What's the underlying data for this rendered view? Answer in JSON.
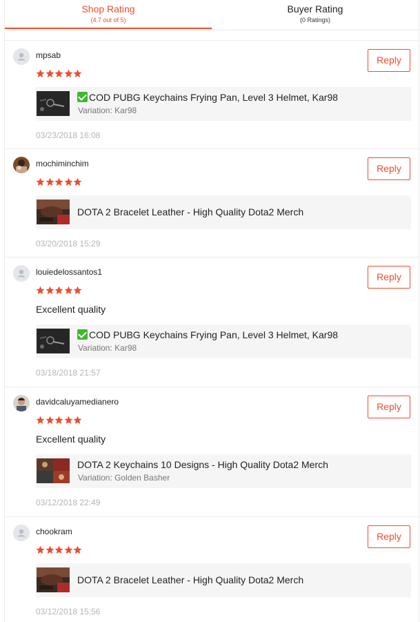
{
  "tabs": {
    "shop": {
      "title": "Shop Rating",
      "subtitle": "(4.7 out of 5)"
    },
    "buyer": {
      "title": "Buyer Rating",
      "subtitle": "(0 Ratings)"
    }
  },
  "colors": {
    "accent": "#ee4d2d",
    "star": "#ee4d2d",
    "check": "#3fb82f"
  },
  "reviews": [
    {
      "username": "mpsab",
      "rating": 5,
      "comment": "",
      "product": "COD PUBG Keychains Frying Pan, Level 3 Helmet, Kar98",
      "has_check": true,
      "variation": "Variation: Kar98",
      "date": "03/23/2018 16:08",
      "reply_label": "Reply",
      "avatar": "default-avatar-icon"
    },
    {
      "username": "mochiminchim",
      "rating": 5,
      "comment": "",
      "product": "DOTA 2 Bracelet Leather - High Quality Dota2 Merch",
      "has_check": false,
      "variation": "",
      "date": "03/20/2018 15:29",
      "reply_label": "Reply",
      "avatar": "user-photo"
    },
    {
      "username": "louiedelossantos1",
      "rating": 5,
      "comment": "Excellent quality",
      "product": "COD PUBG Keychains Frying Pan, Level 3 Helmet, Kar98",
      "has_check": true,
      "variation": "Variation: Kar98",
      "date": "03/18/2018 21:57",
      "reply_label": "Reply",
      "avatar": "default-avatar-icon"
    },
    {
      "username": "davidcaluyamedianero",
      "rating": 5,
      "comment": "Excellent quality",
      "product": "DOTA 2 Keychains 10 Designs - High Quality Dota2 Merch",
      "has_check": false,
      "variation": "Variation: Golden Basher",
      "date": "03/12/2018 22:49",
      "reply_label": "Reply",
      "avatar": "user-photo"
    },
    {
      "username": "chookram",
      "rating": 5,
      "comment": "",
      "product": "DOTA 2 Bracelet Leather - High Quality Dota2 Merch",
      "has_check": false,
      "variation": "",
      "date": "03/12/2018 15:56",
      "reply_label": "Reply",
      "avatar": "default-avatar-icon"
    }
  ]
}
